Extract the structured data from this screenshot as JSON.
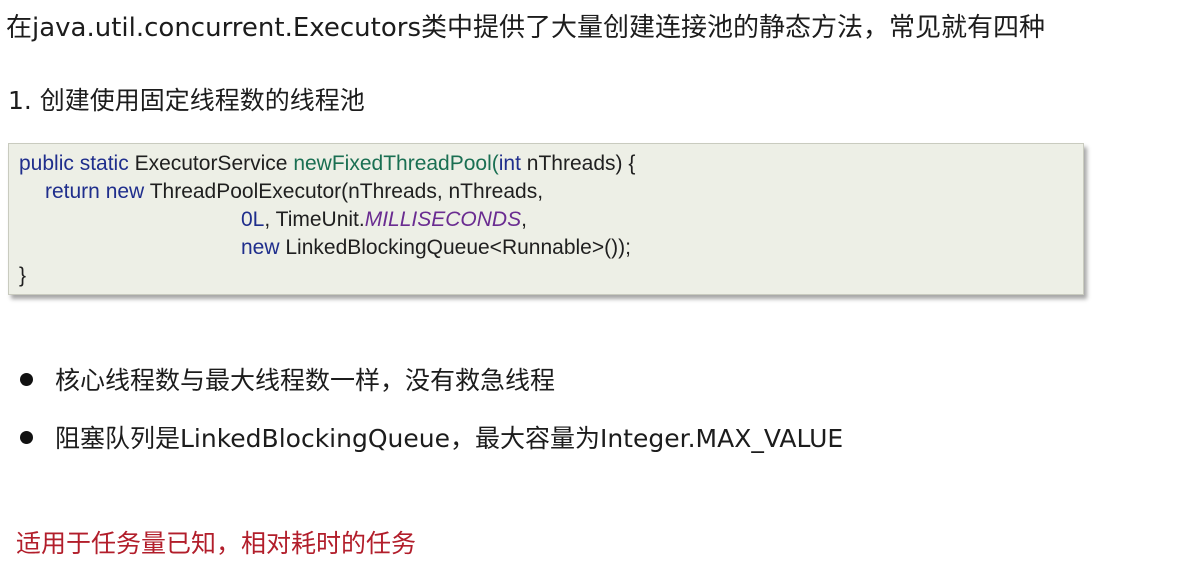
{
  "intro": "在java.util.concurrent.Executors类中提供了大量创建连接池的静态方法，常见就有四种",
  "section_heading": "1. 创建使用固定线程数的线程池",
  "code": {
    "l1_kw": "public static",
    "l1_type": "ExecutorService",
    "l1_method": "newFixedThreadPool",
    "l1_open": "(",
    "l1_int": "int",
    "l1_rest": "nThreads) {",
    "l2_kw": "return new",
    "l2_rest": "ThreadPoolExecutor(nThreads, nThreads,",
    "l3_num": "0L",
    "l3_mid": ", TimeUnit.",
    "l3_const": "MILLISECONDS",
    "l3_end": ",",
    "l4_kw": "new",
    "l4_rest": "LinkedBlockingQueue<Runnable>());",
    "l5": "}"
  },
  "bullets": [
    "核心线程数与最大线程数一样，没有救急线程",
    "阻塞队列是LinkedBlockingQueue，最大容量为Integer.MAX_VALUE"
  ],
  "note": "适用于任务量已知，相对耗时的任务",
  "colors": {
    "note_red": "#b21e2b",
    "code_background": "#edefe6",
    "keyword_blue": "#1f2e8c",
    "method_green": "#1a6f52",
    "constant_purple": "#6a2c91"
  }
}
